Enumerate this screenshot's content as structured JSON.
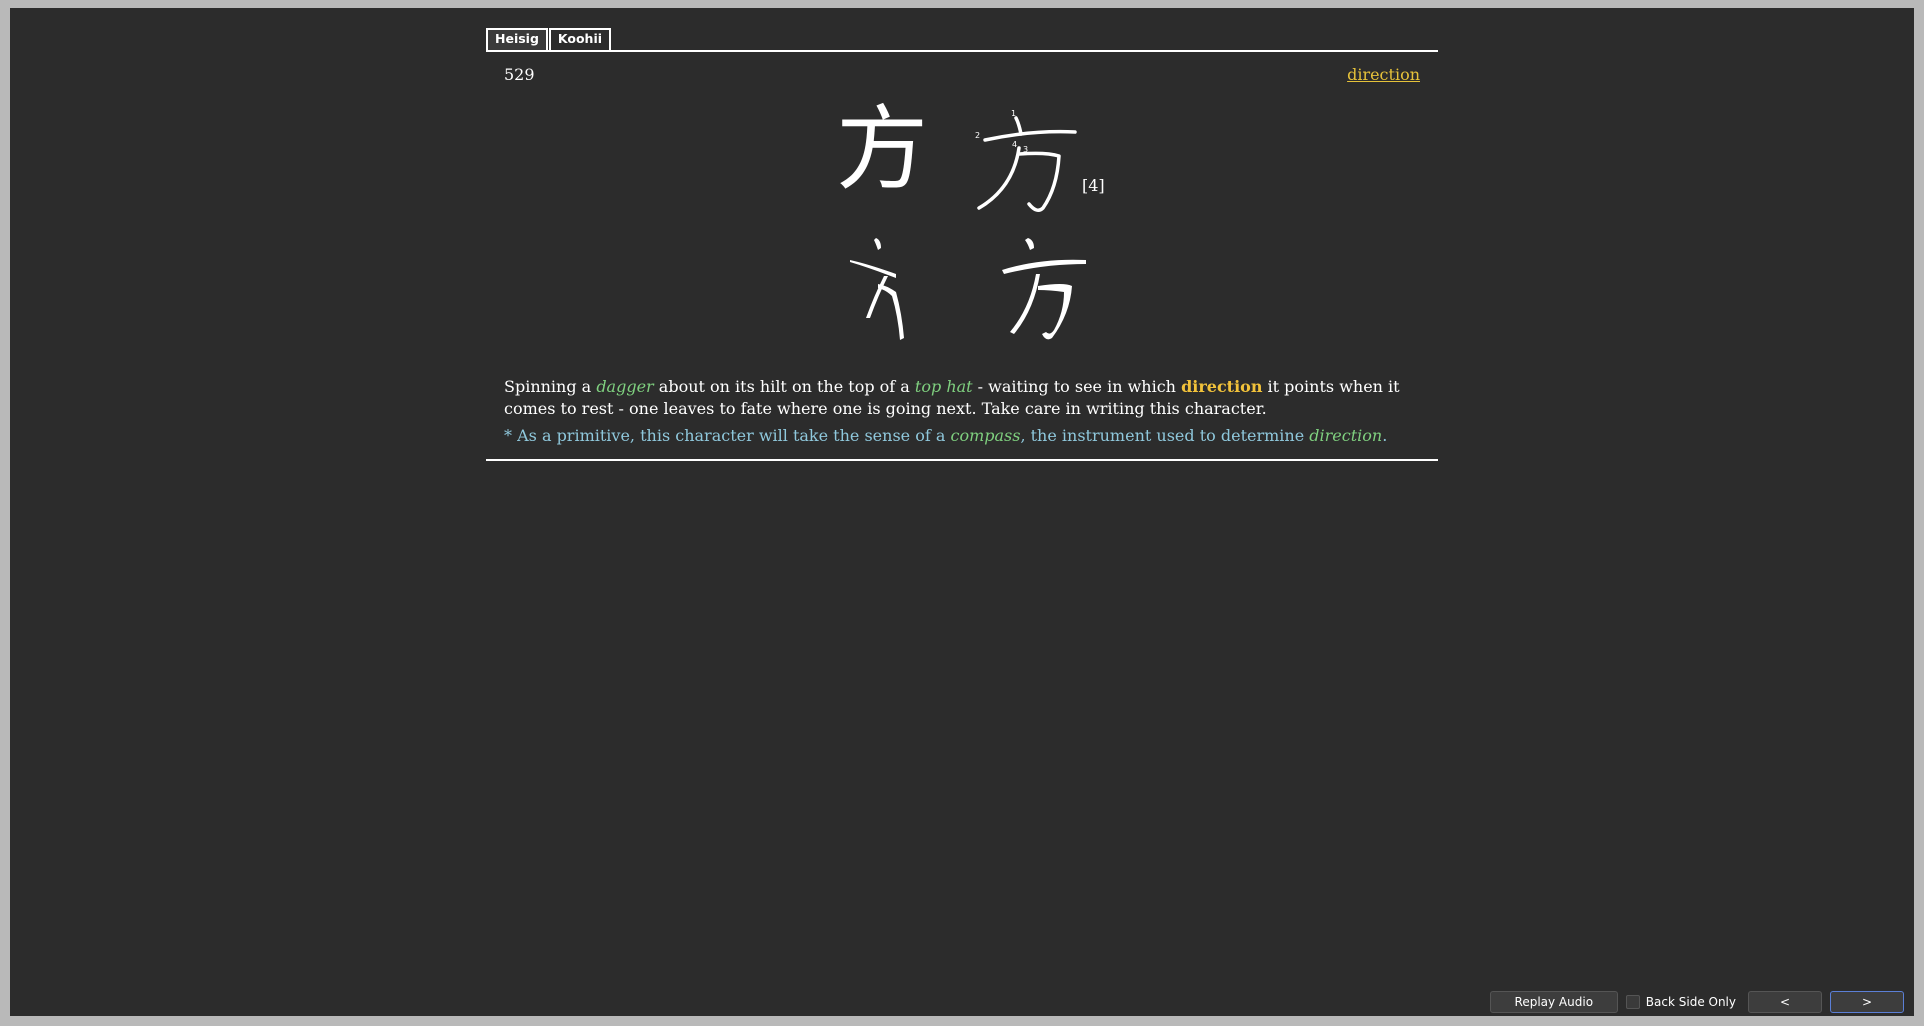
{
  "tabs": [
    {
      "label": "Heisig"
    },
    {
      "label": "Koohii"
    }
  ],
  "card": {
    "frame_number": "529",
    "keyword": "direction",
    "kanji": "方",
    "stroke_count": "[4]",
    "stroke_numbers": [
      "1",
      "2",
      "3",
      "4"
    ],
    "story": {
      "p1": "Spinning a ",
      "e1": "dagger",
      "p2": " about on its hilt on the top of a ",
      "e2": "top hat",
      "p3": " - waiting to see in which ",
      "s1": "direction",
      "p4": " it points when it comes to rest - one leaves to fate where one is going next. Take care in writing this character."
    },
    "note": {
      "p1": "* As a primitive, this character will take the sense of a ",
      "e1": "compass",
      "p2": ", the instrument used to determine ",
      "e2": "direction",
      "p3": "."
    }
  },
  "bottom_bar": {
    "replay_label": "Replay Audio",
    "back_only_label": "Back Side Only",
    "prev_label": "<",
    "next_label": ">"
  },
  "colors": {
    "background": "#2c2c2c",
    "keyword": "#e6c23a",
    "primitive": "#7fd07f",
    "note": "#8fc8dc"
  }
}
